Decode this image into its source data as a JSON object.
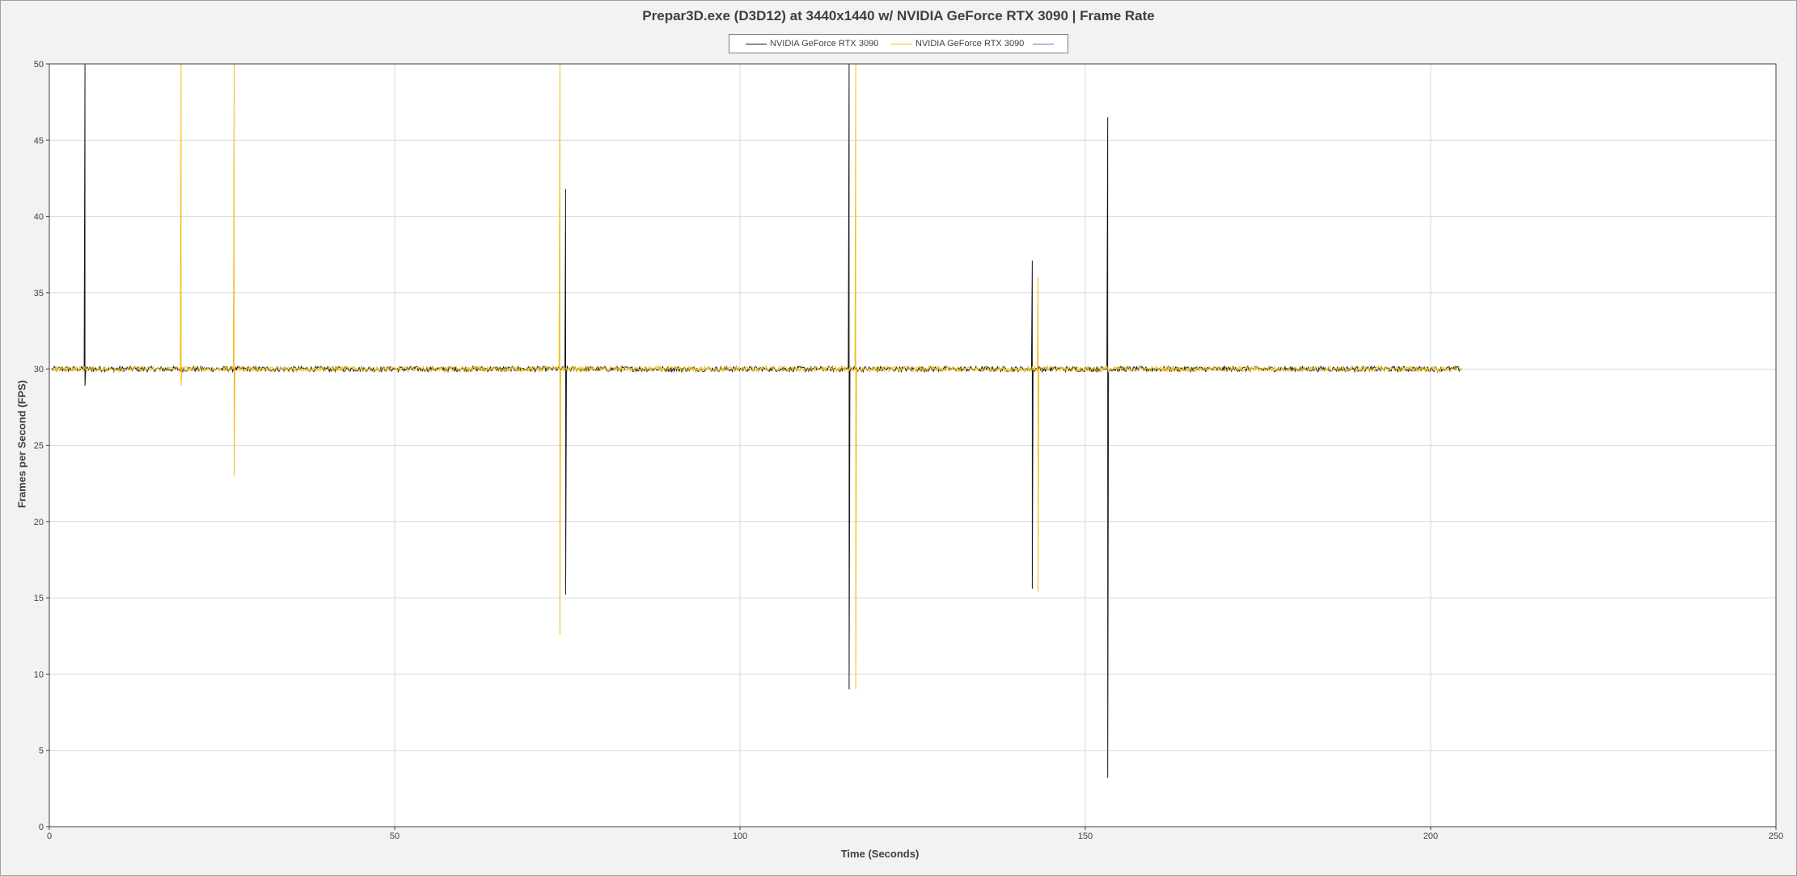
{
  "chart_data": {
    "type": "line",
    "title": "Prepar3D.exe (D3D12) at 3440x1440 w/ NVIDIA GeForce RTX 3090 | Frame Rate",
    "xlabel": "Time (Seconds)",
    "ylabel": "Frames per Second (FPS)",
    "xlim": [
      0,
      250
    ],
    "ylim": [
      0,
      50
    ],
    "x_ticks": [
      0,
      50,
      100,
      150,
      200,
      250
    ],
    "y_ticks": [
      0,
      5,
      10,
      15,
      20,
      25,
      30,
      35,
      40,
      45,
      50
    ],
    "grid": true,
    "legend_position": "top-center",
    "series": [
      {
        "name": "NVIDIA GeForce RTX 3090",
        "color": "#1a1a1a",
        "x_start": 0.3,
        "x_end": 204.5,
        "baseline": 30,
        "spikes": [
          {
            "x": 5.2,
            "values": [
              50,
              28.9
            ]
          },
          {
            "x": 74.8,
            "values": [
              41.8,
              15.2
            ]
          },
          {
            "x": 115.8,
            "values": [
              50,
              9.0
            ]
          },
          {
            "x": 142.3,
            "values": [
              37.1,
              15.6
            ]
          },
          {
            "x": 153.2,
            "values": [
              46.5,
              3.2
            ]
          }
        ]
      },
      {
        "name": "NVIDIA GeForce RTX 3090",
        "color": "#f0c020",
        "x_start": 0.3,
        "x_end": 204.5,
        "baseline": 30,
        "spikes": [
          {
            "x": 19.1,
            "values": [
              50,
              28.9
            ]
          },
          {
            "x": 26.8,
            "values": [
              50,
              23.0
            ]
          },
          {
            "x": 73.9,
            "values": [
              50,
              12.6
            ]
          },
          {
            "x": 116.8,
            "values": [
              50,
              9.0
            ]
          },
          {
            "x": 143.2,
            "values": [
              36.0,
              15.4
            ]
          }
        ]
      },
      {
        "name": "",
        "color": "#7b6fb0",
        "x_start": 0,
        "x_end": 0.3,
        "baseline": 0,
        "spikes": []
      }
    ]
  }
}
